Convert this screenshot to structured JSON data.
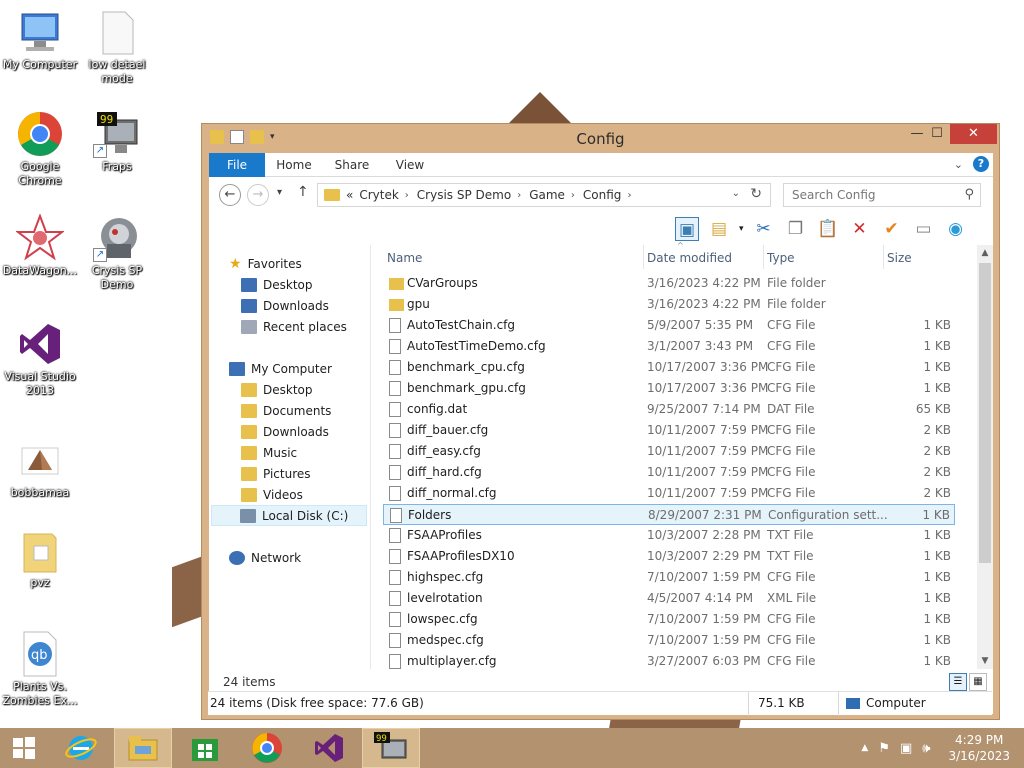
{
  "desktop": {
    "icons": [
      {
        "label": "My Computer",
        "icon": "computer-icon"
      },
      {
        "label": "low detael mode",
        "icon": "blank-file-icon"
      },
      {
        "label": "Google Chrome",
        "icon": "chrome-icon"
      },
      {
        "label": "Fraps",
        "icon": "fraps-icon"
      },
      {
        "label": "DataWagon...",
        "icon": "datawagon-icon"
      },
      {
        "label": "Crysis SP Demo",
        "icon": "crysis-icon"
      },
      {
        "label": "Visual Studio 2013",
        "icon": "visual-studio-icon"
      },
      {
        "label": "bobbamaa",
        "icon": "pyramid-image-icon"
      },
      {
        "label": "pvz",
        "icon": "folder-icon"
      },
      {
        "label": "Plants Vs. Zombies Ex...",
        "icon": "qbittorrent-icon"
      }
    ]
  },
  "window": {
    "title": "Config",
    "ribbon_tabs": [
      "File",
      "Home",
      "Share",
      "View"
    ],
    "breadcrumb": {
      "overflow": "«",
      "items": [
        "Crytek",
        "Crysis SP Demo",
        "Game",
        "Config"
      ]
    },
    "search_placeholder": "Search Config",
    "nav": {
      "favorites": "Favorites",
      "fav_items": [
        "Desktop",
        "Downloads",
        "Recent places"
      ],
      "computer": "My Computer",
      "comp_items": [
        "Desktop",
        "Documents",
        "Downloads",
        "Music",
        "Pictures",
        "Videos",
        "Local Disk (C:)"
      ],
      "network": "Network"
    },
    "columns": {
      "name": "Name",
      "date": "Date modified",
      "type": "Type",
      "size": "Size"
    },
    "files": [
      {
        "name": "CVarGroups",
        "date": "3/16/2023 4:22 PM",
        "type": "File folder",
        "size": "",
        "kind": "folder"
      },
      {
        "name": "gpu",
        "date": "3/16/2023 4:22 PM",
        "type": "File folder",
        "size": "",
        "kind": "folder"
      },
      {
        "name": "AutoTestChain.cfg",
        "date": "5/9/2007 5:35 PM",
        "type": "CFG File",
        "size": "1 KB",
        "kind": "doc"
      },
      {
        "name": "AutoTestTimeDemo.cfg",
        "date": "3/1/2007 3:43 PM",
        "type": "CFG File",
        "size": "1 KB",
        "kind": "doc"
      },
      {
        "name": "benchmark_cpu.cfg",
        "date": "10/17/2007 3:36 PM",
        "type": "CFG File",
        "size": "1 KB",
        "kind": "doc"
      },
      {
        "name": "benchmark_gpu.cfg",
        "date": "10/17/2007 3:36 PM",
        "type": "CFG File",
        "size": "1 KB",
        "kind": "doc"
      },
      {
        "name": "config.dat",
        "date": "9/25/2007 7:14 PM",
        "type": "DAT File",
        "size": "65 KB",
        "kind": "doc"
      },
      {
        "name": "diff_bauer.cfg",
        "date": "10/11/2007 7:59 PM",
        "type": "CFG File",
        "size": "2 KB",
        "kind": "doc"
      },
      {
        "name": "diff_easy.cfg",
        "date": "10/11/2007 7:59 PM",
        "type": "CFG File",
        "size": "2 KB",
        "kind": "doc"
      },
      {
        "name": "diff_hard.cfg",
        "date": "10/11/2007 7:59 PM",
        "type": "CFG File",
        "size": "2 KB",
        "kind": "doc"
      },
      {
        "name": "diff_normal.cfg",
        "date": "10/11/2007 7:59 PM",
        "type": "CFG File",
        "size": "2 KB",
        "kind": "doc"
      },
      {
        "name": "Folders",
        "date": "8/29/2007 2:31 PM",
        "type": "Configuration sett...",
        "size": "1 KB",
        "kind": "config"
      },
      {
        "name": "FSAAProfiles",
        "date": "10/3/2007 2:28 PM",
        "type": "TXT File",
        "size": "1 KB",
        "kind": "doc"
      },
      {
        "name": "FSAAProfilesDX10",
        "date": "10/3/2007 2:29 PM",
        "type": "TXT File",
        "size": "1 KB",
        "kind": "doc"
      },
      {
        "name": "highspec.cfg",
        "date": "7/10/2007 1:59 PM",
        "type": "CFG File",
        "size": "1 KB",
        "kind": "doc"
      },
      {
        "name": "levelrotation",
        "date": "4/5/2007 4:14 PM",
        "type": "XML File",
        "size": "1 KB",
        "kind": "doc"
      },
      {
        "name": "lowspec.cfg",
        "date": "7/10/2007 1:59 PM",
        "type": "CFG File",
        "size": "1 KB",
        "kind": "doc"
      },
      {
        "name": "medspec.cfg",
        "date": "7/10/2007 1:59 PM",
        "type": "CFG File",
        "size": "1 KB",
        "kind": "doc"
      },
      {
        "name": "multiplayer.cfg",
        "date": "3/27/2007 6:03 PM",
        "type": "CFG File",
        "size": "1 KB",
        "kind": "doc"
      }
    ],
    "status_items": "24 items",
    "details": {
      "left": "24 items (Disk free space: 77.6 GB)",
      "size": "75.1 KB",
      "location": "Computer"
    }
  },
  "taskbar": {
    "apps": [
      "start-icon",
      "internet-explorer-icon",
      "file-explorer-icon",
      "store-icon",
      "chrome-icon",
      "visual-studio-icon",
      "fraps-icon"
    ],
    "time": "4:29 PM",
    "date": "3/16/2023"
  }
}
